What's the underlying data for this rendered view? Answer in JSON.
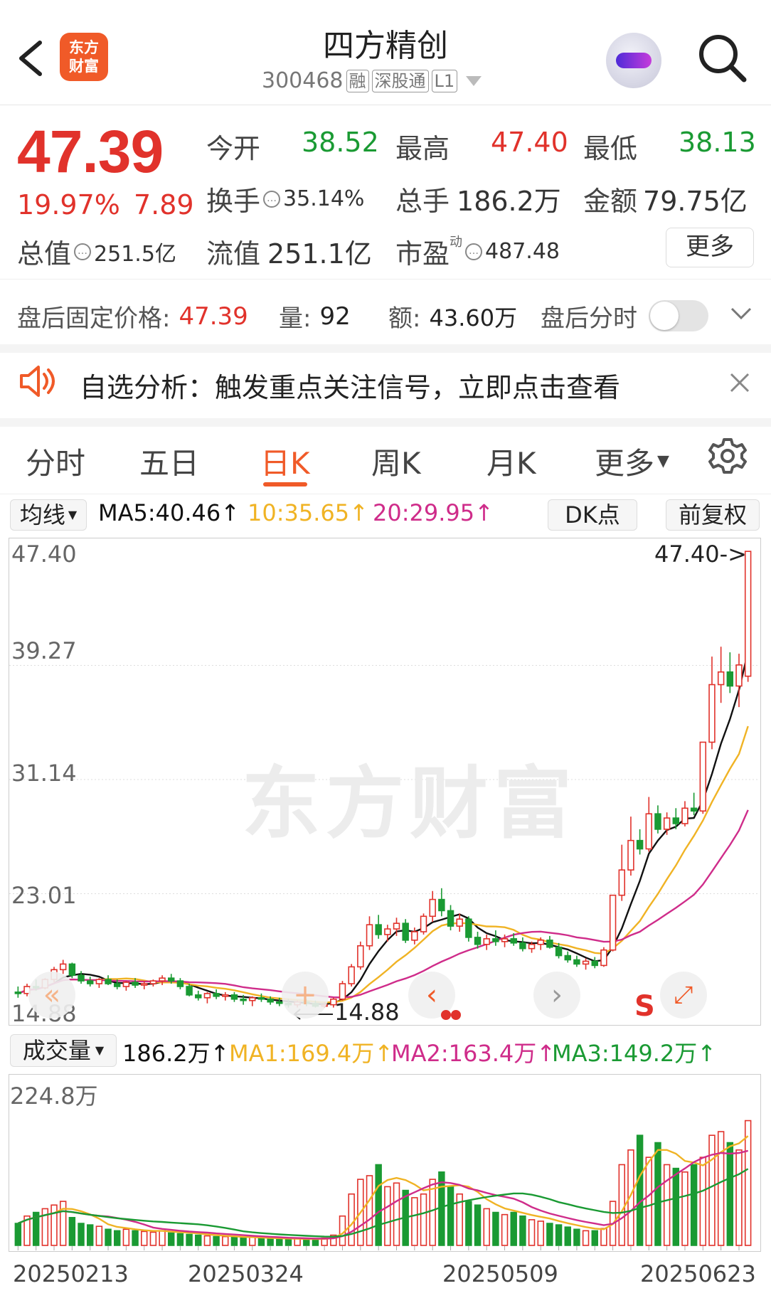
{
  "header": {
    "back_label": "<",
    "logo_text": "东方财富",
    "stock_name": "四方精创",
    "stock_code": "300468",
    "tags": [
      "融",
      "深股通",
      "L1"
    ]
  },
  "quote": {
    "price": "47.39",
    "change_pct": "19.97%",
    "change_abs": "7.89",
    "open_label": "今开",
    "open_value": "38.52",
    "high_label": "最高",
    "high_value": "47.40",
    "low_label": "最低",
    "low_value": "38.13",
    "turnover_label": "换手",
    "turnover_value": "35.14%",
    "volume_label": "总手",
    "volume_value": "186.2万",
    "amount_label": "金额",
    "amount_value": "79.75亿",
    "mktcap_label": "总值",
    "mktcap_value": "251.5亿",
    "float_label": "流值",
    "float_value": "251.1亿",
    "pe_label": "市盈",
    "pe_sup": "动",
    "pe_value": "487.48",
    "more_label": "更多"
  },
  "after_hours": {
    "price_label": "盘后固定价格:",
    "price_value": "47.39",
    "vol_label": "量:",
    "vol_value": "92",
    "amt_label": "额:",
    "amt_value": "43.60万",
    "timeshare_label": "盘后分时",
    "toggle_on": false
  },
  "alert": {
    "text": "自选分析：触发重点关注信号，立即点击查看"
  },
  "tabs": [
    "分时",
    "五日",
    "日K",
    "周K",
    "月K",
    "更多"
  ],
  "active_tab": "日K",
  "ma_row": {
    "selector_label": "均线",
    "ma5": "MA5:40.46↑",
    "ma10": "10:35.65↑",
    "ma20": "20:29.95↑",
    "dk_label": "DK点",
    "adjust_label": "前复权"
  },
  "kline_axis": {
    "y_labels": [
      "47.40",
      "39.27",
      "31.14",
      "23.01",
      "14.88"
    ],
    "high_marker": "47.40->",
    "low_marker": "14.88"
  },
  "watermark": "东方财富",
  "volume_row": {
    "selector_label": "成交量",
    "vol": "186.2万↑",
    "ma1": "MA1:169.4万↑",
    "ma2": "MA2:163.4万↑",
    "ma3": "MA3:149.2万↑",
    "y_max_label": "224.8万"
  },
  "dates": [
    "20250213",
    "20250324",
    "20250509",
    "20250623"
  ],
  "colors": {
    "up": "#e1322b",
    "down": "#1a9a33",
    "ma5": "#111111",
    "ma10": "#f0b324",
    "ma20": "#cf2c8a",
    "accent": "#f05a28"
  },
  "chart_data": {
    "type": "candlestick",
    "y_range": [
      14.88,
      47.4
    ],
    "candles": [
      [
        16.0,
        16.4,
        15.6,
        15.9
      ],
      [
        15.9,
        16.6,
        15.7,
        16.4
      ],
      [
        16.4,
        16.9,
        16.1,
        16.3
      ],
      [
        16.3,
        17.0,
        16.2,
        16.9
      ],
      [
        16.9,
        17.8,
        16.7,
        17.6
      ],
      [
        17.6,
        18.3,
        17.3,
        18.0
      ],
      [
        18.0,
        18.1,
        17.0,
        17.2
      ],
      [
        17.2,
        17.5,
        16.6,
        16.8
      ],
      [
        16.8,
        17.1,
        16.4,
        16.6
      ],
      [
        16.6,
        17.0,
        16.3,
        16.9
      ],
      [
        16.9,
        17.2,
        16.5,
        16.6
      ],
      [
        16.6,
        16.9,
        16.2,
        16.4
      ],
      [
        16.4,
        16.8,
        16.1,
        16.7
      ],
      [
        16.7,
        17.0,
        16.3,
        16.5
      ],
      [
        16.5,
        16.8,
        16.2,
        16.6
      ],
      [
        16.6,
        16.9,
        16.4,
        16.8
      ],
      [
        16.8,
        17.2,
        16.5,
        17.0
      ],
      [
        17.0,
        17.3,
        16.6,
        16.8
      ],
      [
        16.8,
        17.0,
        16.2,
        16.4
      ],
      [
        16.4,
        16.6,
        15.7,
        15.8
      ],
      [
        15.8,
        16.1,
        15.4,
        15.6
      ],
      [
        15.6,
        16.0,
        15.2,
        15.9
      ],
      [
        15.9,
        16.2,
        15.5,
        15.7
      ],
      [
        15.7,
        16.0,
        15.4,
        15.8
      ],
      [
        15.8,
        16.0,
        15.3,
        15.5
      ],
      [
        15.5,
        15.8,
        15.1,
        15.4
      ],
      [
        15.4,
        15.7,
        15.0,
        15.6
      ],
      [
        15.6,
        15.9,
        15.3,
        15.5
      ],
      [
        15.5,
        15.7,
        15.1,
        15.3
      ],
      [
        15.3,
        15.6,
        15.0,
        15.2
      ],
      [
        15.2,
        15.5,
        14.9,
        15.1
      ],
      [
        15.1,
        15.4,
        14.9,
        15.3
      ],
      [
        15.3,
        15.5,
        15.0,
        15.2
      ],
      [
        15.2,
        15.4,
        14.9,
        15.0
      ],
      [
        15.0,
        15.3,
        14.88,
        15.1
      ],
      [
        15.1,
        15.6,
        14.9,
        15.5
      ],
      [
        15.5,
        16.8,
        15.4,
        16.6
      ],
      [
        16.6,
        18.0,
        16.4,
        17.8
      ],
      [
        17.8,
        19.6,
        17.6,
        19.3
      ],
      [
        19.3,
        21.4,
        19.0,
        20.8
      ],
      [
        20.8,
        21.5,
        19.8,
        20.1
      ],
      [
        20.1,
        20.8,
        19.6,
        20.5
      ],
      [
        20.5,
        21.3,
        20.0,
        20.9
      ],
      [
        20.9,
        21.2,
        19.5,
        19.7
      ],
      [
        19.7,
        20.6,
        19.4,
        20.3
      ],
      [
        20.3,
        21.6,
        20.1,
        21.4
      ],
      [
        21.4,
        23.2,
        21.0,
        22.6
      ],
      [
        22.6,
        23.4,
        21.4,
        21.8
      ],
      [
        21.8,
        22.2,
        20.4,
        20.7
      ],
      [
        20.7,
        21.6,
        20.3,
        21.2
      ],
      [
        21.2,
        21.4,
        19.6,
        19.9
      ],
      [
        19.9,
        20.3,
        19.1,
        19.4
      ],
      [
        19.4,
        20.1,
        19.0,
        19.8
      ],
      [
        19.8,
        20.4,
        19.3,
        19.6
      ],
      [
        19.6,
        20.1,
        19.2,
        19.8
      ],
      [
        19.8,
        20.2,
        19.3,
        19.5
      ],
      [
        19.5,
        19.9,
        18.9,
        19.1
      ],
      [
        19.1,
        19.6,
        18.8,
        19.4
      ],
      [
        19.4,
        19.9,
        19.0,
        19.7
      ],
      [
        19.7,
        20.0,
        19.1,
        19.2
      ],
      [
        19.2,
        19.5,
        18.4,
        18.6
      ],
      [
        18.6,
        18.9,
        18.1,
        18.3
      ],
      [
        18.3,
        18.6,
        17.8,
        18.0
      ],
      [
        18.0,
        18.4,
        17.6,
        18.2
      ],
      [
        18.2,
        18.5,
        17.7,
        17.9
      ],
      [
        17.9,
        19.2,
        17.8,
        19.0
      ],
      [
        19.0,
        22.9,
        18.9,
        22.9
      ],
      [
        22.9,
        26.5,
        22.5,
        24.7
      ],
      [
        24.7,
        28.5,
        24.3,
        26.8
      ],
      [
        26.8,
        27.6,
        25.8,
        26.2
      ],
      [
        26.2,
        29.9,
        26.0,
        28.7
      ],
      [
        28.7,
        29.3,
        27.3,
        27.6
      ],
      [
        27.6,
        28.8,
        27.2,
        28.4
      ],
      [
        28.4,
        29.1,
        27.6,
        28.0
      ],
      [
        28.0,
        29.6,
        27.8,
        29.1
      ],
      [
        29.1,
        30.2,
        28.6,
        28.9
      ],
      [
        28.9,
        33.8,
        28.7,
        33.8
      ],
      [
        33.8,
        39.9,
        33.3,
        37.9
      ],
      [
        37.9,
        40.6,
        36.6,
        38.8
      ],
      [
        38.8,
        40.2,
        37.3,
        37.8
      ],
      [
        37.8,
        40.1,
        36.3,
        39.3
      ],
      [
        38.5,
        47.4,
        38.1,
        47.39
      ]
    ],
    "ma5_label": "MA5",
    "ma10_label": "10",
    "ma20_label": "20",
    "volume": [
      30,
      40,
      45,
      50,
      55,
      60,
      38,
      30,
      28,
      26,
      22,
      20,
      22,
      20,
      19,
      18,
      20,
      17,
      16,
      15,
      14,
      13,
      12,
      12,
      11,
      10,
      11,
      10,
      9,
      9,
      8,
      9,
      8,
      9,
      10,
      14,
      40,
      70,
      90,
      95,
      110,
      80,
      85,
      75,
      65,
      70,
      90,
      100,
      80,
      70,
      60,
      55,
      50,
      45,
      42,
      45,
      40,
      35,
      33,
      30,
      28,
      25,
      22,
      20,
      20,
      23,
      60,
      110,
      130,
      150,
      120,
      140,
      110,
      105,
      100,
      110,
      120,
      150,
      155,
      140,
      130,
      170
    ],
    "volume_max": 224.8
  }
}
